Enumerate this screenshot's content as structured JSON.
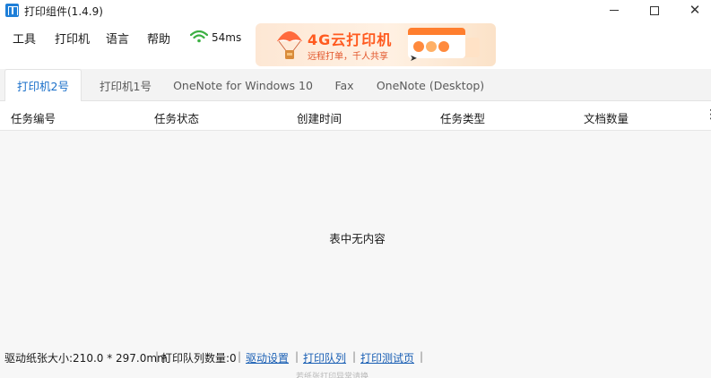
{
  "window": {
    "title": "打印组件(1.4.9)"
  },
  "menu": {
    "items": [
      "工具",
      "打印机",
      "语言",
      "帮助"
    ],
    "ping": "54ms"
  },
  "banner": {
    "title": "4G云打印机",
    "subtitle": "远程打单，千人共享"
  },
  "tabs": [
    {
      "label": "打印机2号",
      "active": true
    },
    {
      "label": "打印机1号",
      "active": false
    },
    {
      "label": "OneNote for Windows 10",
      "active": false
    },
    {
      "label": "Fax",
      "active": false
    },
    {
      "label": "OneNote (Desktop)",
      "active": false
    }
  ],
  "table": {
    "columns": [
      "任务编号",
      "任务状态",
      "创建时间",
      "任务类型",
      "文档数量"
    ],
    "empty_text": "表中无内容"
  },
  "status": {
    "paper_size": "驱动纸张大小:210.0 * 297.0mm",
    "queue_count": "打印队列数量:0",
    "driver_settings": "驱动设置",
    "print_queue": "打印队列",
    "test_page": "打印测试页",
    "footnote": "若纸张打印异常请换"
  },
  "colors": {
    "accent": "#1a6fc9",
    "banner_orange": "#ff5a1f",
    "signal_green": "#3cb043",
    "link": "#1a5fb4"
  }
}
